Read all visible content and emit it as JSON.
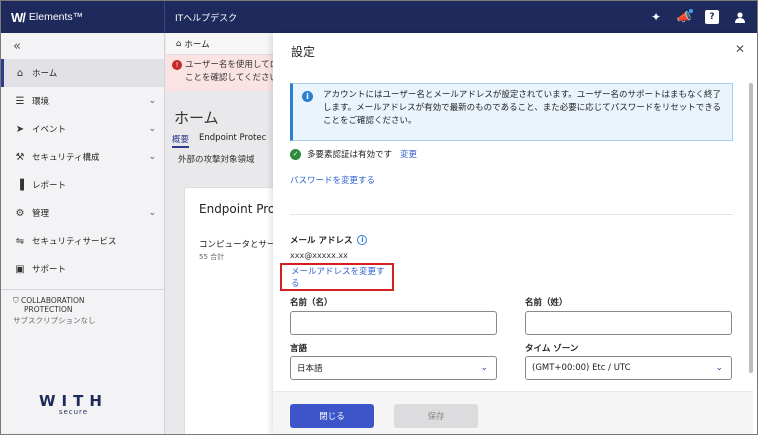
{
  "topbar": {
    "logo": "W/",
    "brand": "Elements™",
    "org": "ITヘルプデスク"
  },
  "sidebar": {
    "collapse_glyph": "«",
    "items": [
      {
        "label": "ホーム",
        "icon": "home-icon"
      },
      {
        "label": "環境",
        "icon": "list-icon"
      },
      {
        "label": "イベント",
        "icon": "event-icon"
      },
      {
        "label": "セキュリティ構成",
        "icon": "tools-icon"
      },
      {
        "label": "レポート",
        "icon": "bar-chart-icon"
      },
      {
        "label": "管理",
        "icon": "gear-icon"
      },
      {
        "label": "セキュリティサービス",
        "icon": "services-icon"
      },
      {
        "label": "サポート",
        "icon": "support-icon"
      }
    ],
    "collab_title_1": "COLLABORATION",
    "collab_title_2": "PROTECTION",
    "collab_sub": "サブスクリプションなし",
    "footer_brand": "WITH",
    "footer_sub": "secure"
  },
  "main": {
    "breadcrumb": "ホーム",
    "alert_line1": "ユーザー名を使用してロ",
    "alert_line2": "ことを確認してください。",
    "title": "ホーム",
    "tab_overview": "概要",
    "tab_endpoint": "Endpoint Protec",
    "subtab": "外部の攻撃対象領域",
    "card_title": "Endpoint Pro",
    "card_sub": "コンピュータとサー",
    "card_count": "55 合計"
  },
  "panel": {
    "title": "設定",
    "info_text": "アカウントにはユーザー名とメールアドレスが設定されています。ユーザー名のサポートはまもなく終了します。メールアドレスが有効で最新のものであること、また必要に応じてパスワードをリセットできることをご確認ください。",
    "mfa_text": "多要素認証は有効です",
    "mfa_change": "変更",
    "password_change": "パスワードを変更する",
    "email_label": "メール アドレス",
    "email_value": "xxx@xxxxx.xx",
    "email_change": "メールアドレスを変更する",
    "first_name_label": "名前（名）",
    "first_name_value": "",
    "last_name_label": "名前（姓）",
    "last_name_value": "",
    "language_label": "言語",
    "language_value": "日本語",
    "timezone_label": "タイム ゾーン",
    "timezone_value": "(GMT+00:00) Etc / UTC",
    "close_button": "閉じる",
    "save_button": "保存"
  },
  "colors": {
    "topbar": "#1f2a5c",
    "primary_button": "#3d55c9",
    "highlight_box": "#d32020",
    "info_border": "#2e7fcf"
  }
}
